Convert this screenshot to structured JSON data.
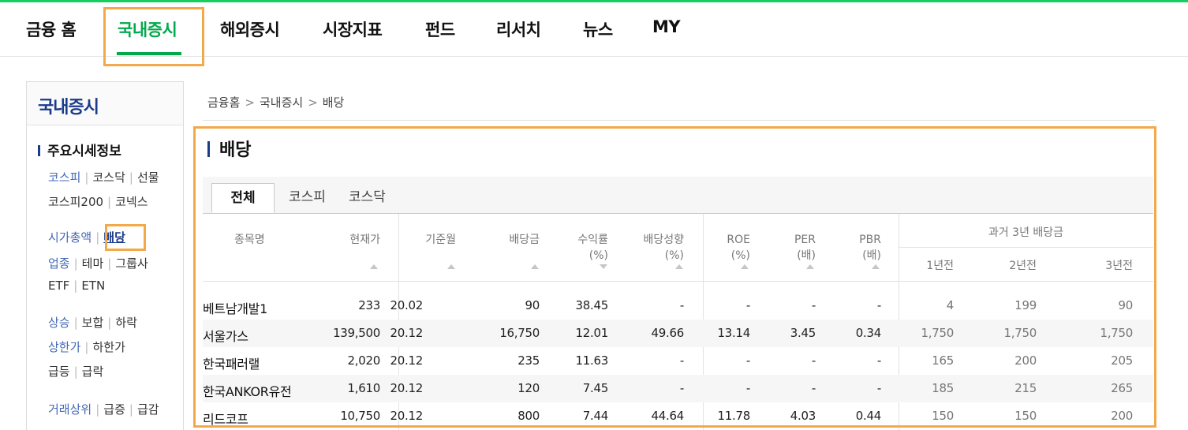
{
  "gnb": [
    "금융 홈",
    "국내증시",
    "해외증시",
    "시장지표",
    "펀드",
    "리서치",
    "뉴스",
    "MY"
  ],
  "lnb": {
    "title": "국내증시",
    "section": "주요시세정보",
    "items": [
      "코스피",
      "코스닥",
      "선물",
      "코스피200",
      "코넥스",
      "시가총액",
      "배당",
      "업종",
      "테마",
      "그룹사",
      "ETF",
      "ETN",
      "상승",
      "보합",
      "하락",
      "상한가",
      "하한가",
      "급등",
      "급락",
      "거래상위",
      "급증",
      "급감"
    ]
  },
  "breadcrumb": [
    "금융홈",
    "국내증시",
    "배당"
  ],
  "page_title": "배당",
  "tabs": [
    "전체",
    "코스피",
    "코스닥"
  ],
  "table": {
    "headers": {
      "name": "종목명",
      "price": "현재가",
      "base_month": "기준월",
      "dividend": "배당금",
      "yield_label": "수익률",
      "yield_unit": "(%)",
      "payout_label": "배당성향",
      "payout_unit": "(%)",
      "roe_label": "ROE",
      "roe_unit": "(%)",
      "per_label": "PER",
      "per_unit": "(배)",
      "pbr_label": "PBR",
      "pbr_unit": "(배)",
      "past_group": "과거 3년 배당금",
      "past1": "1년전",
      "past2": "2년전",
      "past3": "3년전"
    },
    "rows": [
      [
        "베트남개발1",
        "233",
        "20.02",
        "90",
        "38.45",
        "-",
        "-",
        "-",
        "-",
        "4",
        "199",
        "90"
      ],
      [
        "서울가스",
        "139,500",
        "20.12",
        "16,750",
        "12.01",
        "49.66",
        "13.14",
        "3.45",
        "0.34",
        "1,750",
        "1,750",
        "1,750"
      ],
      [
        "한국패러랠",
        "2,020",
        "20.12",
        "235",
        "11.63",
        "-",
        "-",
        "-",
        "-",
        "165",
        "200",
        "205"
      ],
      [
        "한국ANKOR유전",
        "1,610",
        "20.12",
        "120",
        "7.45",
        "-",
        "-",
        "-",
        "-",
        "185",
        "215",
        "265"
      ],
      [
        "리드코프",
        "10,750",
        "20.12",
        "800",
        "7.44",
        "44.64",
        "11.78",
        "4.03",
        "0.44",
        "150",
        "150",
        "200"
      ]
    ]
  }
}
